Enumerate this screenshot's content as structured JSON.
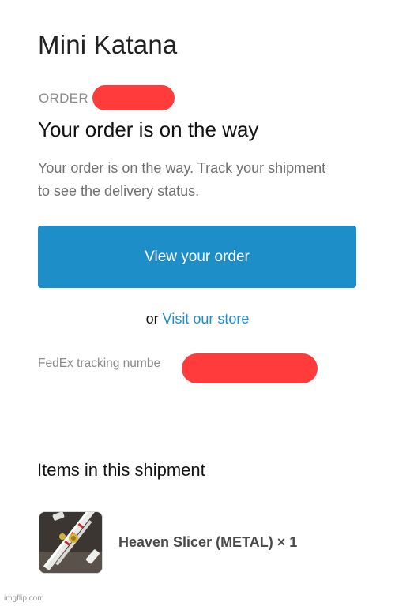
{
  "store": {
    "name": "Mini Katana"
  },
  "order": {
    "label": "ORDER",
    "headline": "Your order is on the way",
    "description": "Your order is on the way. Track your shipment to see the delivery status."
  },
  "actions": {
    "view_order_label": "View your order",
    "or_text": "or",
    "visit_store_label": "Visit our store"
  },
  "tracking": {
    "label": "FedEx tracking numbe"
  },
  "shipment": {
    "title": "Items in this shipment",
    "items": [
      {
        "name": "Heaven Slicer (METAL) × 1",
        "thumbnail": "katana-product-photo"
      }
    ]
  },
  "watermark": "imgflip.com",
  "colors": {
    "accent": "#1e8ec9",
    "redaction": "#ff3b3b"
  }
}
